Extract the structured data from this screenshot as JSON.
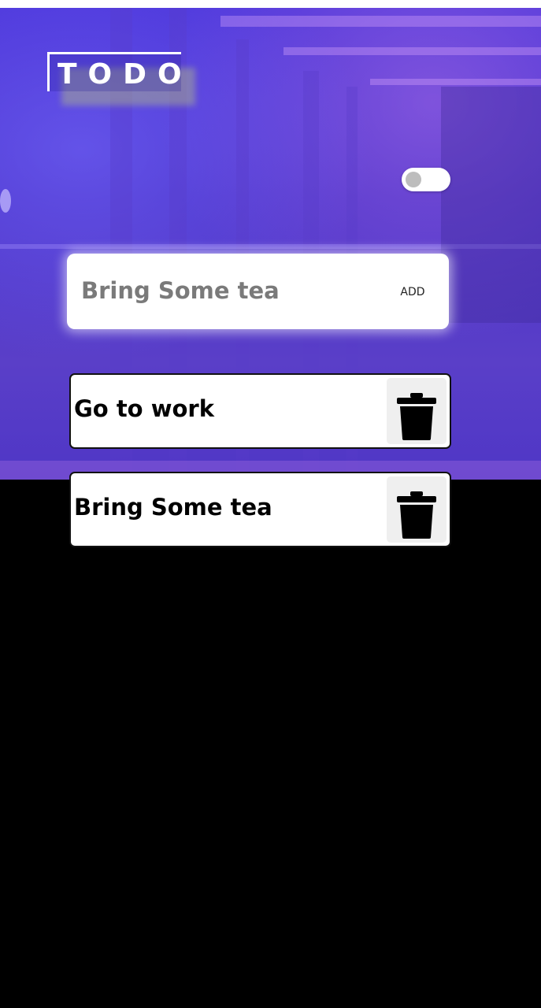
{
  "app": {
    "logo_text": "TODO"
  },
  "theme_toggle": {
    "state": "off"
  },
  "new_todo": {
    "value": "Bring Some tea",
    "add_label": "ADD"
  },
  "todos": [
    {
      "text": "Go to work",
      "delete_icon": "trash-icon"
    },
    {
      "text": "Bring Some tea",
      "delete_icon": "trash-icon"
    }
  ],
  "colors": {
    "hero_primary": "#4b34d9",
    "hero_secondary": "#5a3fc8",
    "background": "#000000",
    "card": "#ffffff",
    "delete_button_bg": "#efefef",
    "input_text": "#7a7a7a"
  }
}
